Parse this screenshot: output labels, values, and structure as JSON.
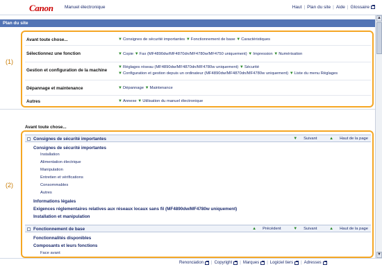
{
  "brand": {
    "logo": "Canon",
    "app_title": "Manuel électronique"
  },
  "toplinks": {
    "home": "Haut",
    "sitemap": "Plan du site",
    "help": "Aide",
    "glossary": "Glossaire"
  },
  "site_header": "Plan du site",
  "sitemap_rows": [
    {
      "category": "Avant toute chose...",
      "links": [
        "Consignes de sécurité importantes",
        "Fonctionnement de base",
        "Caractéristiques"
      ]
    },
    {
      "category": "Sélectionnez une fonction",
      "links": [
        "Copie",
        "Fax (MF4890dw/MF4870dn/MF4780w/MF4750 uniquement)",
        "Impression",
        "Numérisation"
      ]
    },
    {
      "category": "Gestion et configuration de la machine",
      "links": [
        "Réglages réseau (MF4890dw/MF4870dn/MF4780w uniquement)",
        "Sécurité"
      ],
      "links2": [
        "Configuration et gestion depuis un ordinateur (MF4890dw/MF4870dn/MF4780w uniquement)",
        "Liste du menu Réglages"
      ]
    },
    {
      "category": "Dépannage et maintenance",
      "links": [
        "Dépannage",
        "Maintenance"
      ]
    },
    {
      "category": "Autres",
      "links": [
        "Annexe",
        "Utilisation du manuel électronique"
      ]
    }
  ],
  "callouts": {
    "one": "(1)",
    "two": "(2)"
  },
  "section_title": "Avant toute chose...",
  "block1": {
    "title": "Consignes de sécurité importantes",
    "nav_next": "Suivant",
    "nav_top": "Haut de la page",
    "items": [
      {
        "text": "Consignes de sécurité importantes",
        "level": 1
      },
      {
        "text": "Installation",
        "level": 2
      },
      {
        "text": "Alimentation électrique",
        "level": 2
      },
      {
        "text": "Manipulation",
        "level": 2
      },
      {
        "text": "Entretien et vérifications",
        "level": 2
      },
      {
        "text": "Consommables",
        "level": 2
      },
      {
        "text": "Autres",
        "level": 2
      },
      {
        "text": "Informations légales",
        "level": 1
      },
      {
        "text": "Exigences réglementaires relatives aux réseaux locaux sans fil (MF4890dw/MF4780w uniquement)",
        "level": 1
      },
      {
        "text": "Installation et manipulation",
        "level": 1
      }
    ]
  },
  "block2": {
    "title": "Fonctionnement de base",
    "nav_prev": "Précédent",
    "nav_next": "Suivant",
    "nav_top": "Haut de la page",
    "items": [
      {
        "text": "Fonctionnalités disponibles",
        "level": 1
      },
      {
        "text": "Composants et leurs fonctions",
        "level": 1
      },
      {
        "text": "Face avant",
        "level": 2
      }
    ]
  },
  "footer": {
    "links": [
      "Renonciation",
      "Copyright",
      "Marques",
      "Logiciel tiers",
      "Adresses"
    ]
  },
  "colors": {
    "accent_outline": "#f5a623",
    "header_blue": "#5274b5",
    "link_blue": "#1a2a6c",
    "logo_red": "#cc0000"
  }
}
